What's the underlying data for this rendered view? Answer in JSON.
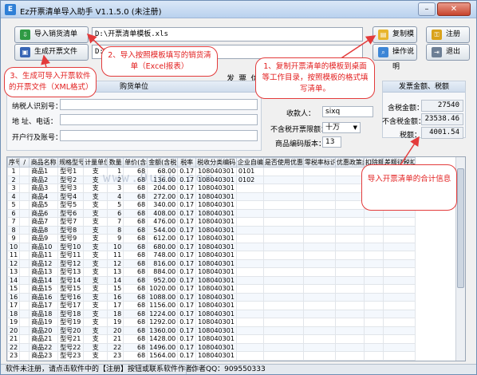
{
  "window": {
    "title": "Ez开票清单导入助手 V1.1.5.0 (未注册)",
    "icon_glyph": "E"
  },
  "toolbar": {
    "import_label": "导入销货清单",
    "import_path": "D:\\开票清单模板.xls",
    "generate_label": "生成开票文件",
    "generate_path": "D:\\",
    "copy_template_label": "复制模板",
    "register_label": "注册",
    "help_label": "操作说明",
    "exit_label": "退出"
  },
  "invoice_info": {
    "title": "发 票 信 息"
  },
  "buyer": {
    "title": "购货单位",
    "tax_id_label": "纳税人识别号：",
    "address_label": "地 址、电话：",
    "bank_label": "开户行及账号：",
    "tax_id": "",
    "address": "",
    "bank": ""
  },
  "options": {
    "payee_label": "收款人：",
    "payee": "sixq",
    "limit_label": "不含税开票限额：",
    "limit": "十万",
    "code_version_label": "商品编码版本：",
    "code_version": "13"
  },
  "totals": {
    "title": "发票金额、税额",
    "tax_incl_label": "含税金额：",
    "tax_incl": "27540",
    "tax_excl_label": "不含税金额：",
    "tax_excl": "23538.46",
    "tax_label": "税额：",
    "tax": "4001.54"
  },
  "table": {
    "headers": [
      "序号",
      "/",
      "商品名称",
      "规格型号",
      "计量单位",
      "数量",
      "单价(含税)",
      "金额(含税)",
      "税率",
      "税收分类编码",
      "企业自编码",
      "是否使用优惠政策",
      "零税率标识",
      "优惠政策类型",
      "扣除额",
      "差额征税扣除额"
    ],
    "rows": [
      [
        "1",
        "商品1",
        "型号1",
        "支",
        "1",
        "68",
        "68.00",
        "0.17",
        "108040301",
        "0101"
      ],
      [
        "2",
        "商品2",
        "型号2",
        "支",
        "2",
        "68",
        "136.00",
        "0.17",
        "108040301",
        "0102"
      ],
      [
        "3",
        "商品3",
        "型号3",
        "支",
        "3",
        "68",
        "204.00",
        "0.17",
        "108040301",
        ""
      ],
      [
        "4",
        "商品4",
        "型号4",
        "支",
        "4",
        "68",
        "272.00",
        "0.17",
        "108040301",
        ""
      ],
      [
        "5",
        "商品5",
        "型号5",
        "支",
        "5",
        "68",
        "340.00",
        "0.17",
        "108040301",
        ""
      ],
      [
        "6",
        "商品6",
        "型号6",
        "支",
        "6",
        "68",
        "408.00",
        "0.17",
        "108040301",
        ""
      ],
      [
        "7",
        "商品7",
        "型号7",
        "支",
        "7",
        "68",
        "476.00",
        "0.17",
        "108040301",
        ""
      ],
      [
        "8",
        "商品8",
        "型号8",
        "支",
        "8",
        "68",
        "544.00",
        "0.17",
        "108040301",
        ""
      ],
      [
        "9",
        "商品9",
        "型号9",
        "支",
        "9",
        "68",
        "612.00",
        "0.17",
        "108040301",
        ""
      ],
      [
        "10",
        "商品10",
        "型号10",
        "支",
        "10",
        "68",
        "680.00",
        "0.17",
        "108040301",
        ""
      ],
      [
        "11",
        "商品11",
        "型号11",
        "支",
        "11",
        "68",
        "748.00",
        "0.17",
        "108040301",
        ""
      ],
      [
        "12",
        "商品12",
        "型号12",
        "支",
        "12",
        "68",
        "816.00",
        "0.17",
        "108040301",
        ""
      ],
      [
        "13",
        "商品13",
        "型号13",
        "支",
        "13",
        "68",
        "884.00",
        "0.17",
        "108040301",
        ""
      ],
      [
        "14",
        "商品14",
        "型号14",
        "支",
        "14",
        "68",
        "952.00",
        "0.17",
        "108040301",
        ""
      ],
      [
        "15",
        "商品15",
        "型号15",
        "支",
        "15",
        "68",
        "1020.00",
        "0.17",
        "108040301",
        ""
      ],
      [
        "16",
        "商品16",
        "型号16",
        "支",
        "16",
        "68",
        "1088.00",
        "0.17",
        "108040301",
        ""
      ],
      [
        "17",
        "商品17",
        "型号17",
        "支",
        "17",
        "68",
        "1156.00",
        "0.17",
        "108040301",
        ""
      ],
      [
        "18",
        "商品18",
        "型号18",
        "支",
        "18",
        "68",
        "1224.00",
        "0.17",
        "108040301",
        ""
      ],
      [
        "19",
        "商品19",
        "型号19",
        "支",
        "19",
        "68",
        "1292.00",
        "0.17",
        "108040301",
        ""
      ],
      [
        "20",
        "商品20",
        "型号20",
        "支",
        "20",
        "68",
        "1360.00",
        "0.17",
        "108040301",
        ""
      ],
      [
        "21",
        "商品21",
        "型号21",
        "支",
        "21",
        "68",
        "1428.00",
        "0.17",
        "108040301",
        ""
      ],
      [
        "22",
        "商品22",
        "型号22",
        "支",
        "22",
        "68",
        "1496.00",
        "0.17",
        "108040301",
        ""
      ],
      [
        "23",
        "商品23",
        "型号23",
        "支",
        "23",
        "68",
        "1564.00",
        "0.17",
        "108040301",
        ""
      ],
      [
        "24",
        "商品24",
        "型号24",
        "支",
        "24",
        "68",
        "1632.00",
        "0.17",
        "108040301",
        ""
      ]
    ]
  },
  "status": {
    "left": "软件未注册，请点击软件中的【注册】按钮或联系软件作者。",
    "right": "作者QQ：909550333"
  },
  "callouts": {
    "c1": "1、复制开票清单的模板到桌面等工作目录，按照模板的格式填写清单。",
    "c2": "2、导入按照模板填写的销货清单（Excel报表）",
    "c3": "3、生成可导入开票软件的开票文件（XML格式）",
    "c4": "导入开票清单的合计信息"
  },
  "watermark": "www.9upk.com",
  "colors": {
    "accent": "#e33b3b",
    "title_bar": "#b9d1ee"
  }
}
